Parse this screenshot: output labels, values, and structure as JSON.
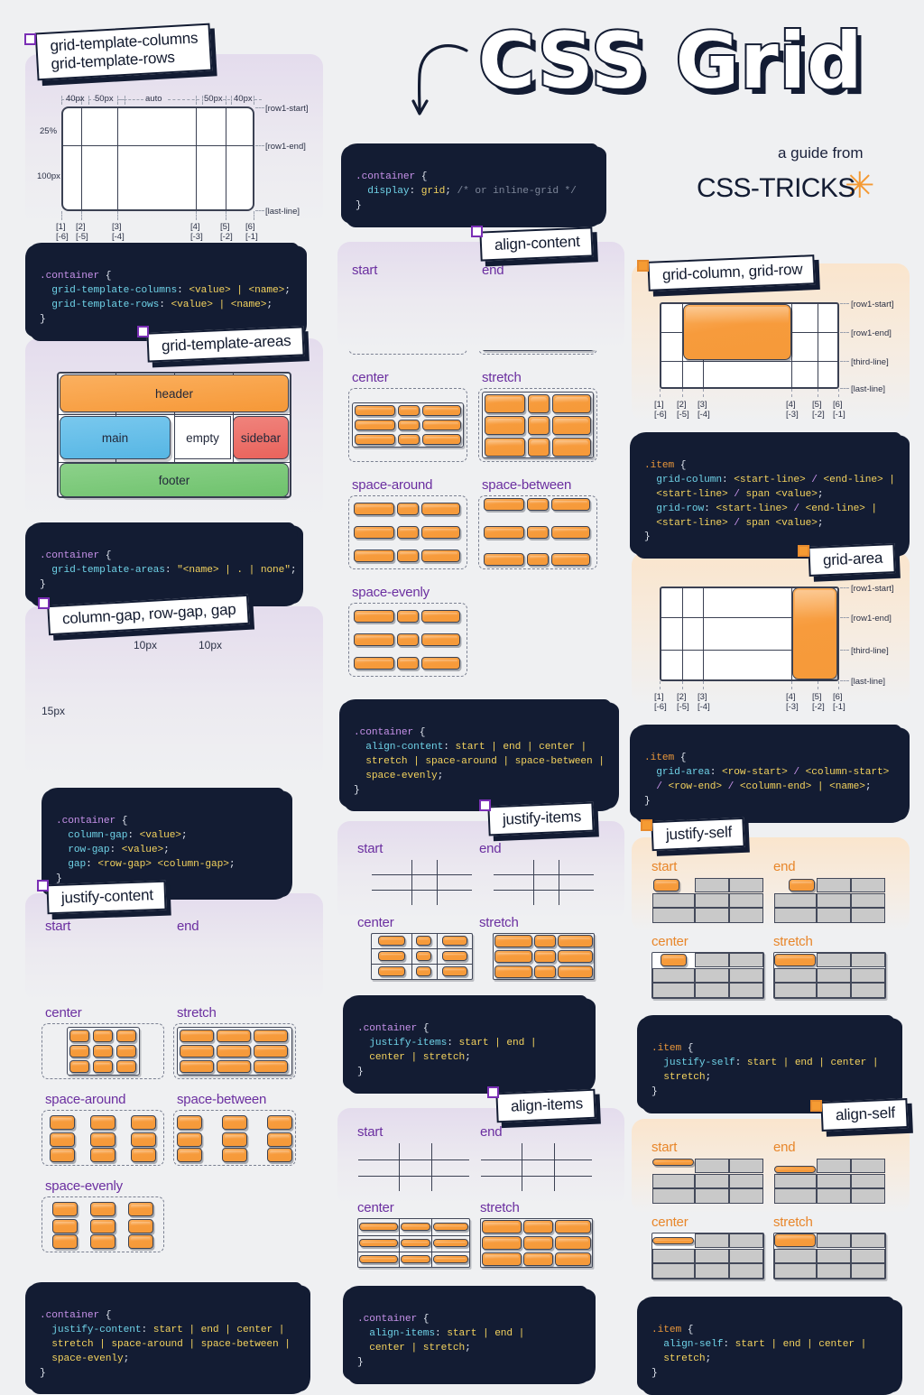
{
  "header": {
    "title": "CSS Grid",
    "guide_from": "a guide from",
    "brand": "CSS-TRICKS",
    "asterisk": "✳",
    "display_code": [
      ".container {",
      "  display: grid; /* or inline-grid */",
      "}"
    ]
  },
  "sections": {
    "template_cols_rows": {
      "label": "grid-template-columns\ngrid-template-rows",
      "col_labels": [
        "40px",
        "50px",
        "auto",
        "50px",
        "40px"
      ],
      "row_labels": [
        "25%",
        "100px"
      ],
      "line_names": [
        "[row1-start]",
        "[row1-end]",
        "[last-line]"
      ],
      "col_indices_pos": [
        "[1]",
        "[2]",
        "[3]",
        "[4]",
        "[5]",
        "[6]"
      ],
      "col_indices_neg": [
        "[-6]",
        "[-5]",
        "[-4]",
        "[-3]",
        "[-2]",
        "[-1]"
      ],
      "code": [
        ".container {",
        "  grid-template-columns: <value> | <name>;",
        "  grid-template-rows: <value> | <name>;",
        "}"
      ]
    },
    "template_areas": {
      "label": "grid-template-areas",
      "areas": [
        "header",
        "main",
        "empty",
        "sidebar",
        "footer"
      ],
      "code": [
        ".container {",
        "  grid-template-areas: \"<name> | . | none\";",
        "}"
      ]
    },
    "gaps": {
      "label": "column-gap, row-gap, gap",
      "col_gap_labels": [
        "10px",
        "10px"
      ],
      "row_gap_label": "15px",
      "code": [
        ".container {",
        "  column-gap: <value>;",
        "  row-gap: <value>;",
        "  gap: <row-gap> <column-gap>;",
        "}"
      ]
    },
    "justify_content": {
      "label": "justify-content",
      "variants": [
        "start",
        "end",
        "center",
        "stretch",
        "space-around",
        "space-between",
        "space-evenly"
      ],
      "code": [
        ".container {",
        "  justify-content: start | end | center |",
        "  stretch | space-around | space-between |",
        "  space-evenly;",
        "}"
      ]
    },
    "align_content": {
      "label": "align-content",
      "variants": [
        "start",
        "end",
        "center",
        "stretch",
        "space-around",
        "space-between",
        "space-evenly"
      ],
      "code": [
        ".container {",
        "  align-content: start | end | center |",
        "  stretch | space-around | space-between |",
        "  space-evenly;",
        "}"
      ]
    },
    "justify_items": {
      "label": "justify-items",
      "variants": [
        "start",
        "end",
        "center",
        "stretch"
      ],
      "code": [
        ".container {",
        "  justify-items: start | end |",
        "  center | stretch;",
        "}"
      ]
    },
    "align_items": {
      "label": "align-items",
      "variants": [
        "start",
        "end",
        "center",
        "stretch"
      ],
      "code": [
        ".container {",
        "  align-items: start | end |",
        "  center | stretch;",
        "}"
      ]
    },
    "grid_column_row": {
      "label": "grid-column, grid-row",
      "line_names": [
        "[row1-start]",
        "[row1-end]",
        "[third-line]",
        "[last-line]"
      ],
      "col_indices_pos": [
        "[1]",
        "[2]",
        "[3]",
        "[4]",
        "[5]",
        "[6]"
      ],
      "col_indices_neg": [
        "[-6]",
        "[-5]",
        "[-4]",
        "[-3]",
        "[-2]",
        "[-1]"
      ],
      "code": [
        ".item {",
        "  grid-column: <start-line> / <end-line> |",
        "  <start-line> / span <value>;",
        "  grid-row: <start-line> / <end-line> |",
        "  <start-line> / span <value>;",
        "}"
      ]
    },
    "grid_area": {
      "label": "grid-area",
      "line_names": [
        "[row1-start]",
        "[row1-end]",
        "[third-line]",
        "[last-line]"
      ],
      "col_indices_pos": [
        "[1]",
        "[2]",
        "[3]",
        "[4]",
        "[5]",
        "[6]"
      ],
      "col_indices_neg": [
        "[-6]",
        "[-5]",
        "[-4]",
        "[-3]",
        "[-2]",
        "[-1]"
      ],
      "code": [
        ".item {",
        "  grid-area: <row-start> / <column-start>",
        "  / <row-end> / <column-end> | <name>;",
        "}"
      ]
    },
    "justify_self": {
      "label": "justify-self",
      "variants": [
        "start",
        "end",
        "center",
        "stretch"
      ],
      "code": [
        ".item {",
        "  justify-self: start | end | center |",
        "  stretch;",
        "}"
      ]
    },
    "align_self": {
      "label": "align-self",
      "variants": [
        "start",
        "end",
        "center",
        "stretch"
      ],
      "code": [
        ".item {",
        "  align-self: start | end | center |",
        "  stretch;",
        "}"
      ]
    }
  },
  "colors": {
    "background": "#eff0f2",
    "ink": "#131c33",
    "orange": "#f59a39",
    "purple_label": "#6b2fa0",
    "orange_label": "#e8862a",
    "panel_purple": "#e4dced",
    "panel_peach": "#fae5cd",
    "area_header": "#f69837",
    "area_main": "#56b6e4",
    "area_sidebar": "#e9635c",
    "area_footer": "#6ec26c",
    "grey_cell": "#c9c9c9"
  }
}
